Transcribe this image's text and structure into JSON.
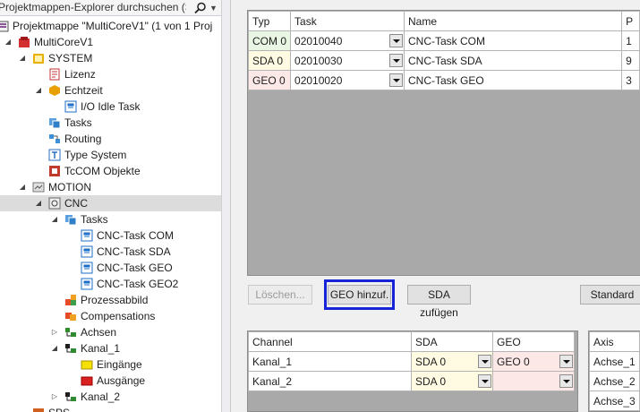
{
  "explorer": {
    "search_placeholder": "Projektmappen-Explorer durchsuchen (S",
    "search_icon": "search-icon",
    "items": [
      {
        "label": "Projektmappe \"MultiCoreV1\" (1 von 1 Proj",
        "icon": "solution-icon",
        "expander": "",
        "level": 0
      },
      {
        "label": "MultiCoreV1",
        "icon": "project-icon",
        "expander": "expanded",
        "level": 0
      },
      {
        "label": "SYSTEM",
        "icon": "system-icon",
        "expander": "expanded",
        "level": 1
      },
      {
        "label": "Lizenz",
        "icon": "license-icon",
        "expander": "",
        "level": 2
      },
      {
        "label": "Echtzeit",
        "icon": "realtime-icon",
        "expander": "expanded",
        "level": 2
      },
      {
        "label": "I/O Idle Task",
        "icon": "task-icon",
        "expander": "",
        "level": 3
      },
      {
        "label": "Tasks",
        "icon": "tasks-icon",
        "expander": "",
        "level": 2
      },
      {
        "label": "Routing",
        "icon": "routing-icon",
        "expander": "",
        "level": 2
      },
      {
        "label": "Type System",
        "icon": "type-system-icon",
        "expander": "",
        "level": 2
      },
      {
        "label": "TcCOM Objekte",
        "icon": "tccom-icon",
        "expander": "",
        "level": 2
      },
      {
        "label": "MOTION",
        "icon": "motion-icon",
        "expander": "expanded",
        "level": 1
      },
      {
        "label": "CNC",
        "icon": "cnc-icon",
        "expander": "expanded",
        "level": 2,
        "selected": true
      },
      {
        "label": "Tasks",
        "icon": "tasks-icon",
        "expander": "expanded",
        "level": 3
      },
      {
        "label": "CNC-Task COM",
        "icon": "task-icon",
        "expander": "",
        "level": 4
      },
      {
        "label": "CNC-Task SDA",
        "icon": "task-icon",
        "expander": "",
        "level": 4
      },
      {
        "label": "CNC-Task GEO",
        "icon": "task-icon",
        "expander": "",
        "level": 4
      },
      {
        "label": "CNC-Task GEO2",
        "icon": "task-icon",
        "expander": "",
        "level": 4
      },
      {
        "label": "Prozessabbild",
        "icon": "process-image-icon",
        "expander": "",
        "level": 3
      },
      {
        "label": "Compensations",
        "icon": "compensations-icon",
        "expander": "",
        "level": 3
      },
      {
        "label": "Achsen",
        "icon": "axes-icon",
        "expander": "collapsed",
        "level": 3
      },
      {
        "label": "Kanal_1",
        "icon": "channel-icon",
        "expander": "expanded",
        "level": 3
      },
      {
        "label": "Eingänge",
        "icon": "inputs-icon",
        "expander": "",
        "level": 4
      },
      {
        "label": "Ausgänge",
        "icon": "outputs-icon",
        "expander": "",
        "level": 4
      },
      {
        "label": "Kanal_2",
        "icon": "channel-icon",
        "expander": "collapsed",
        "level": 3
      },
      {
        "label": "SPS",
        "icon": "plc-icon",
        "expander": "",
        "level": 1
      }
    ]
  },
  "task_grid": {
    "headers": [
      "Typ",
      "Task",
      "Name",
      "P"
    ],
    "rows": [
      {
        "typ": "COM 0",
        "task": "02010040",
        "name": "CNC-Task COM",
        "p": "1",
        "color": "#eaf6e4"
      },
      {
        "typ": "SDA 0",
        "task": "02010030",
        "name": "CNC-Task SDA",
        "p": "9",
        "color": "#fffbe2"
      },
      {
        "typ": "GEO 0",
        "task": "02010020",
        "name": "CNC-Task GEO",
        "p": "3",
        "color": "#fde8e8"
      }
    ]
  },
  "buttons": {
    "delete": "Löschen...",
    "add_geo": "GEO hinzuf.",
    "add_sda": "SDA zufügen",
    "standard": "Standard"
  },
  "channel_grid": {
    "headers": [
      "Channel",
      "SDA",
      "GEO"
    ],
    "rows": [
      {
        "channel": "Kanal_1",
        "sda": "SDA 0",
        "geo": "GEO 0"
      },
      {
        "channel": "Kanal_2",
        "sda": "SDA 0",
        "geo": ""
      }
    ],
    "sda_color": "#fffbe2",
    "geo_color": "#fde8e8"
  },
  "axis_grid": {
    "header": "Axis",
    "rows": [
      "Achse_1",
      "Achse_2",
      "Achse_3"
    ]
  }
}
